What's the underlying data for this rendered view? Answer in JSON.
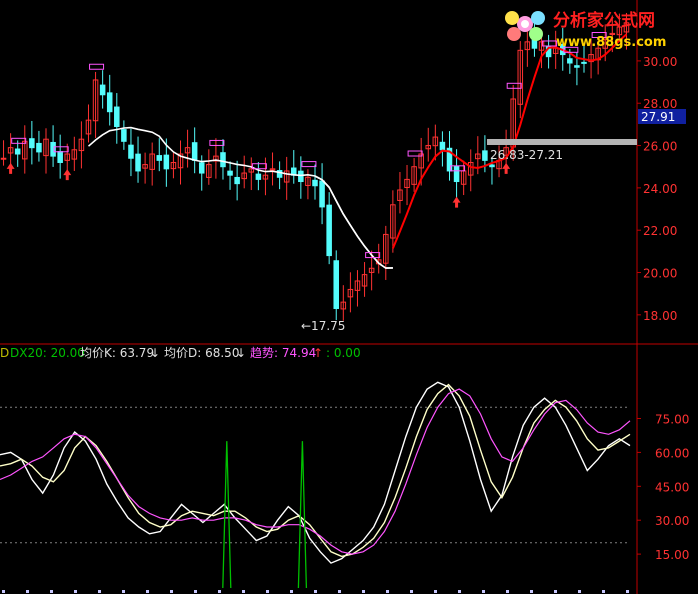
{
  "watermark": {
    "title": "分析家公式网",
    "url": "www.88gs.com"
  },
  "price_chart": {
    "y_ticks": [
      "30.00",
      "28.00",
      "26.00",
      "24.00",
      "22.00",
      "20.00",
      "18.00"
    ],
    "current_price_label": "27.91",
    "range_label": "26.83-27.21",
    "low_marker_label": "←17.75",
    "colors": {
      "up": "#ff3232",
      "down": "#54fcfc",
      "ma_white": "#ffffff",
      "ma_red": "#ff0000",
      "signal": "#ff55ff",
      "axis": "#c00000"
    }
  },
  "indicator_header": {
    "dx_label": "DX20: 20.00",
    "k_label": "均价K: 63.79",
    "d_label": "均价D: 68.50",
    "trend_label": "趋势: 74.94",
    "zero_label": ": 0.00",
    "arrow_down": "↓",
    "arrow_up": "↑"
  },
  "indicator_chart": {
    "y_ticks": [
      "75.00",
      "60.00",
      "45.00",
      "30.00",
      "15.00"
    ]
  },
  "chart_data": [
    {
      "type": "candlestick",
      "ylim": [
        17,
        32.5
      ],
      "y_ticks": [
        18,
        20,
        22,
        24,
        26,
        28,
        30
      ],
      "low_value": 17.75,
      "current_price": 27.91,
      "range_band": [
        26.83,
        27.21
      ],
      "close_path": [
        25.4,
        25.9,
        25.6,
        26.2,
        25.9,
        25.7,
        26.3,
        25.5,
        25.2,
        25.6,
        25.8,
        26.3,
        27.2,
        29.1,
        28.4,
        27.6,
        26.9,
        26.2,
        25.4,
        24.8,
        25.1,
        25.6,
        25.3,
        24.9,
        25.2,
        25.6,
        25.9,
        25.3,
        24.7,
        25.1,
        25.5,
        25.0,
        24.6,
        24.2,
        24.7,
        24.9,
        24.4,
        24.6,
        24.9,
        24.5,
        24.8,
        24.6,
        24.3,
        24.5,
        24.1,
        23.1,
        20.8,
        18.3,
        18.6,
        19.2,
        19.6,
        19.9,
        20.2,
        20.6,
        21.8,
        23.2,
        23.9,
        24.4,
        25.0,
        25.6,
        26.0,
        26.4,
        25.8,
        24.8,
        24.3,
        24.8,
        25.2,
        25.6,
        25.3,
        25.0,
        25.3,
        25.9,
        28.2,
        30.5,
        30.9,
        30.6,
        30.9,
        30.2,
        30.6,
        30.3,
        29.9,
        29.7,
        29.9,
        30.3,
        30.6,
        31.0,
        31.3,
        31.6,
        31.8
      ]
    },
    {
      "type": "line",
      "ylim": [
        0,
        100
      ],
      "y_ticks": [
        15,
        30,
        45,
        60,
        75
      ],
      "series": [
        {
          "name": "均价K",
          "values": [
            59,
            60,
            57,
            48,
            42,
            50,
            62,
            69,
            65,
            57,
            46,
            38,
            31,
            27,
            24,
            25,
            31,
            37,
            33,
            29,
            33,
            37,
            31,
            26,
            21,
            23,
            30,
            36,
            32,
            22,
            16,
            11,
            13,
            17,
            21,
            27,
            37,
            52,
            67,
            80,
            88,
            91,
            89,
            80,
            65,
            48,
            34,
            41,
            58,
            72,
            80,
            84,
            80,
            72,
            62,
            52,
            57,
            63,
            66,
            63
          ]
        },
        {
          "name": "均价D",
          "values": [
            54,
            55,
            57,
            54,
            49,
            47,
            52,
            62,
            67,
            63,
            56,
            48,
            40,
            33,
            29,
            27,
            28,
            32,
            34,
            33,
            32,
            34,
            34,
            31,
            27,
            25,
            26,
            30,
            32,
            28,
            22,
            16,
            14,
            15,
            18,
            22,
            29,
            40,
            53,
            67,
            79,
            86,
            90,
            85,
            76,
            61,
            47,
            40,
            49,
            62,
            73,
            79,
            83,
            80,
            74,
            66,
            61,
            62,
            65,
            68
          ]
        },
        {
          "name": "趋势",
          "values": [
            48,
            50,
            53,
            56,
            58,
            62,
            66,
            68,
            67,
            62,
            55,
            48,
            41,
            36,
            33,
            31,
            30,
            30,
            31,
            30,
            30,
            31,
            31,
            30,
            28,
            27,
            27,
            28,
            28,
            26,
            23,
            19,
            16,
            15,
            16,
            19,
            25,
            34,
            46,
            59,
            71,
            80,
            86,
            88,
            85,
            77,
            66,
            58,
            56,
            62,
            70,
            77,
            82,
            83,
            79,
            73,
            69,
            68,
            70,
            74
          ]
        },
        {
          "name": "DX20",
          "values": [
            20,
            20,
            20,
            20,
            20,
            20,
            20,
            20,
            20,
            20,
            20,
            20,
            20,
            20,
            20,
            20,
            20,
            20,
            20,
            20,
            20,
            20,
            20,
            20,
            20,
            20,
            20,
            20,
            20,
            20,
            20,
            20,
            20,
            20,
            20,
            20,
            20,
            20,
            20,
            20,
            20,
            20,
            20,
            20,
            20,
            20,
            20,
            20,
            20,
            20,
            20,
            20,
            20,
            20,
            20,
            20,
            20,
            20,
            20,
            20
          ]
        },
        {
          "name": "spikes",
          "values": [
            0,
            0,
            0,
            0,
            0,
            0,
            0,
            0,
            0,
            0,
            0,
            0,
            0,
            0,
            0,
            0,
            0,
            0,
            0,
            0,
            0,
            0,
            0,
            0,
            0,
            0,
            0,
            0,
            0,
            0,
            0,
            0,
            0,
            0,
            0,
            0,
            0,
            0,
            0,
            0,
            0,
            0,
            0,
            0,
            0,
            0,
            0,
            0,
            0,
            0,
            0,
            0,
            0,
            0,
            0,
            0,
            0,
            0,
            0,
            0
          ]
        }
      ],
      "spike_positions": [
        0.36,
        0.48
      ],
      "spike_value": 65,
      "ref_lines": [
        20,
        80
      ]
    }
  ]
}
